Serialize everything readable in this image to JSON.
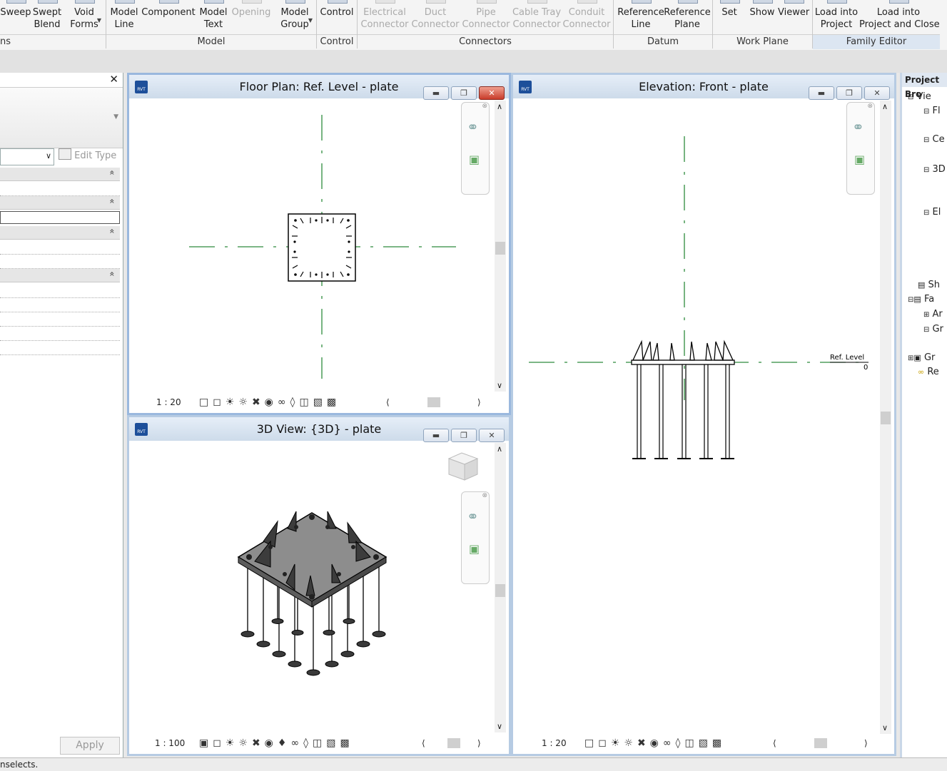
{
  "ribbon": {
    "tools": [
      {
        "id": "sweep",
        "label": "Sweep",
        "disabled": false
      },
      {
        "id": "swept-blend",
        "label": "Swept\nBlend",
        "disabled": false
      },
      {
        "id": "void-forms",
        "label": "Void\nForms",
        "disabled": false
      },
      {
        "id": "model-line",
        "label": "Model\nLine",
        "disabled": false
      },
      {
        "id": "component",
        "label": "Component",
        "disabled": false
      },
      {
        "id": "model-text",
        "label": "Model\nText",
        "disabled": false
      },
      {
        "id": "opening",
        "label": "Opening",
        "disabled": true
      },
      {
        "id": "model-group",
        "label": "Model\nGroup",
        "disabled": false
      },
      {
        "id": "control",
        "label": "Control",
        "disabled": false
      },
      {
        "id": "electrical-connector",
        "label": "Electrical\nConnector",
        "disabled": true
      },
      {
        "id": "duct-connector",
        "label": "Duct\nConnector",
        "disabled": true
      },
      {
        "id": "pipe-connector",
        "label": "Pipe\nConnector",
        "disabled": true
      },
      {
        "id": "cable-tray-connector",
        "label": "Cable Tray\nConnector",
        "disabled": true
      },
      {
        "id": "conduit-connector",
        "label": "Conduit\nConnector",
        "disabled": true
      },
      {
        "id": "reference-line",
        "label": "Reference\nLine",
        "disabled": false
      },
      {
        "id": "reference-plane",
        "label": "Reference\nPlane",
        "disabled": false
      },
      {
        "id": "set",
        "label": "Set",
        "disabled": false
      },
      {
        "id": "show",
        "label": "Show",
        "disabled": false
      },
      {
        "id": "viewer",
        "label": "Viewer",
        "disabled": false
      },
      {
        "id": "load-into-project",
        "label": "Load into\nProject",
        "disabled": false
      },
      {
        "id": "load-into-project-close",
        "label": "Load into\nProject and Close",
        "disabled": false
      }
    ],
    "groups": [
      {
        "id": "forms",
        "label": "ns",
        "active": false
      },
      {
        "id": "model",
        "label": "Model",
        "active": false
      },
      {
        "id": "control",
        "label": "Control",
        "active": false
      },
      {
        "id": "connectors",
        "label": "Connectors",
        "active": false
      },
      {
        "id": "datum",
        "label": "Datum",
        "active": false
      },
      {
        "id": "work-plane",
        "label": "Work Plane",
        "active": false
      },
      {
        "id": "family-editor",
        "label": "Family Editor",
        "active": true
      }
    ]
  },
  "properties": {
    "edit_type": "Edit Type",
    "apply": "Apply",
    "collapse_glyph": "»"
  },
  "views": {
    "floor_plan": {
      "title": "Floor Plan: Ref. Level - plate",
      "scale": "1 : 20"
    },
    "three_d": {
      "title": "3D View: {3D} - plate",
      "scale": "1 : 100"
    },
    "elevation": {
      "title": "Elevation: Front - plate",
      "scale": "1 : 20",
      "level_name": "Ref. Level",
      "level_value": "0"
    },
    "rvt_badge": "RVT"
  },
  "browser": {
    "title": "Project Bro",
    "nodes": [
      "Vie",
      "Fl",
      "Ce",
      "3D",
      "El",
      "Sh",
      "Fa",
      "Ar",
      "Gr",
      "Gr",
      "Re"
    ]
  },
  "status": {
    "text": "nselects."
  },
  "colors": {
    "datum_green": "#2e8b3d",
    "title_bar": "#cddbea",
    "close_red": "#c83b2a"
  }
}
